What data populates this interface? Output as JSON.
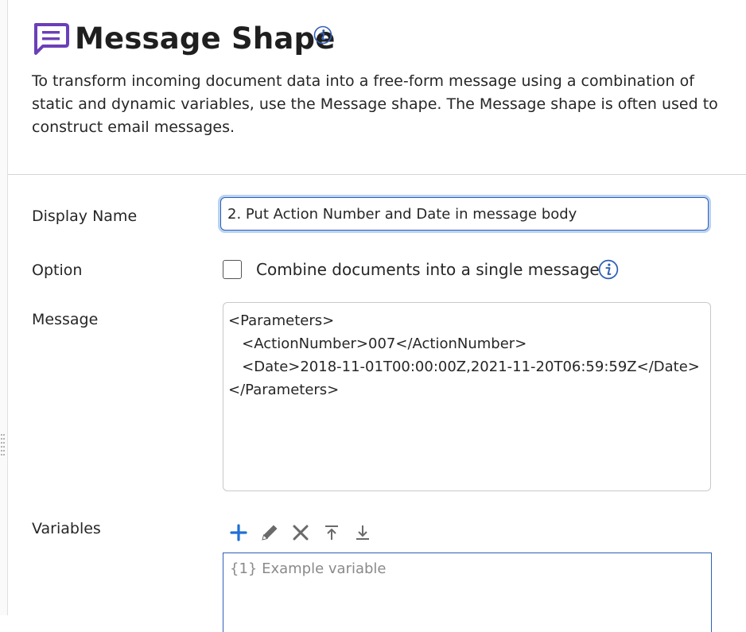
{
  "header": {
    "title": "Message Shape",
    "title_icon": "message-shape-icon",
    "info_icon": "info-icon"
  },
  "description": "To transform incoming document data into a free-form message using a combination of static and dynamic variables, use the Message shape. The Message shape is often used to construct email messages.",
  "form": {
    "display_name": {
      "label": "Display Name",
      "value": "2. Put Action Number and Date in message body"
    },
    "option": {
      "label": "Option",
      "checkbox_label": "Combine documents into a single message",
      "checked": false,
      "info_icon": "info-icon"
    },
    "message": {
      "label": "Message",
      "lines": [
        "<Parameters>",
        "   <ActionNumber>007</ActionNumber>",
        "   <Date>2018-11-01T00:00:00Z,2021-11-20T06:59:59Z</Date>",
        "</Parameters>"
      ]
    },
    "variables": {
      "label": "Variables",
      "toolbar": [
        "plus-icon",
        "pencil-icon",
        "close-icon",
        "move-to-top-icon",
        "move-to-bottom-icon"
      ],
      "items": [
        "{1} Example variable"
      ]
    }
  },
  "colors": {
    "brand_purple": "#6b3fb8",
    "info_blue": "#2f5fb3",
    "add_blue": "#1f6fd6",
    "focus_ring": "#b9d3f2"
  }
}
